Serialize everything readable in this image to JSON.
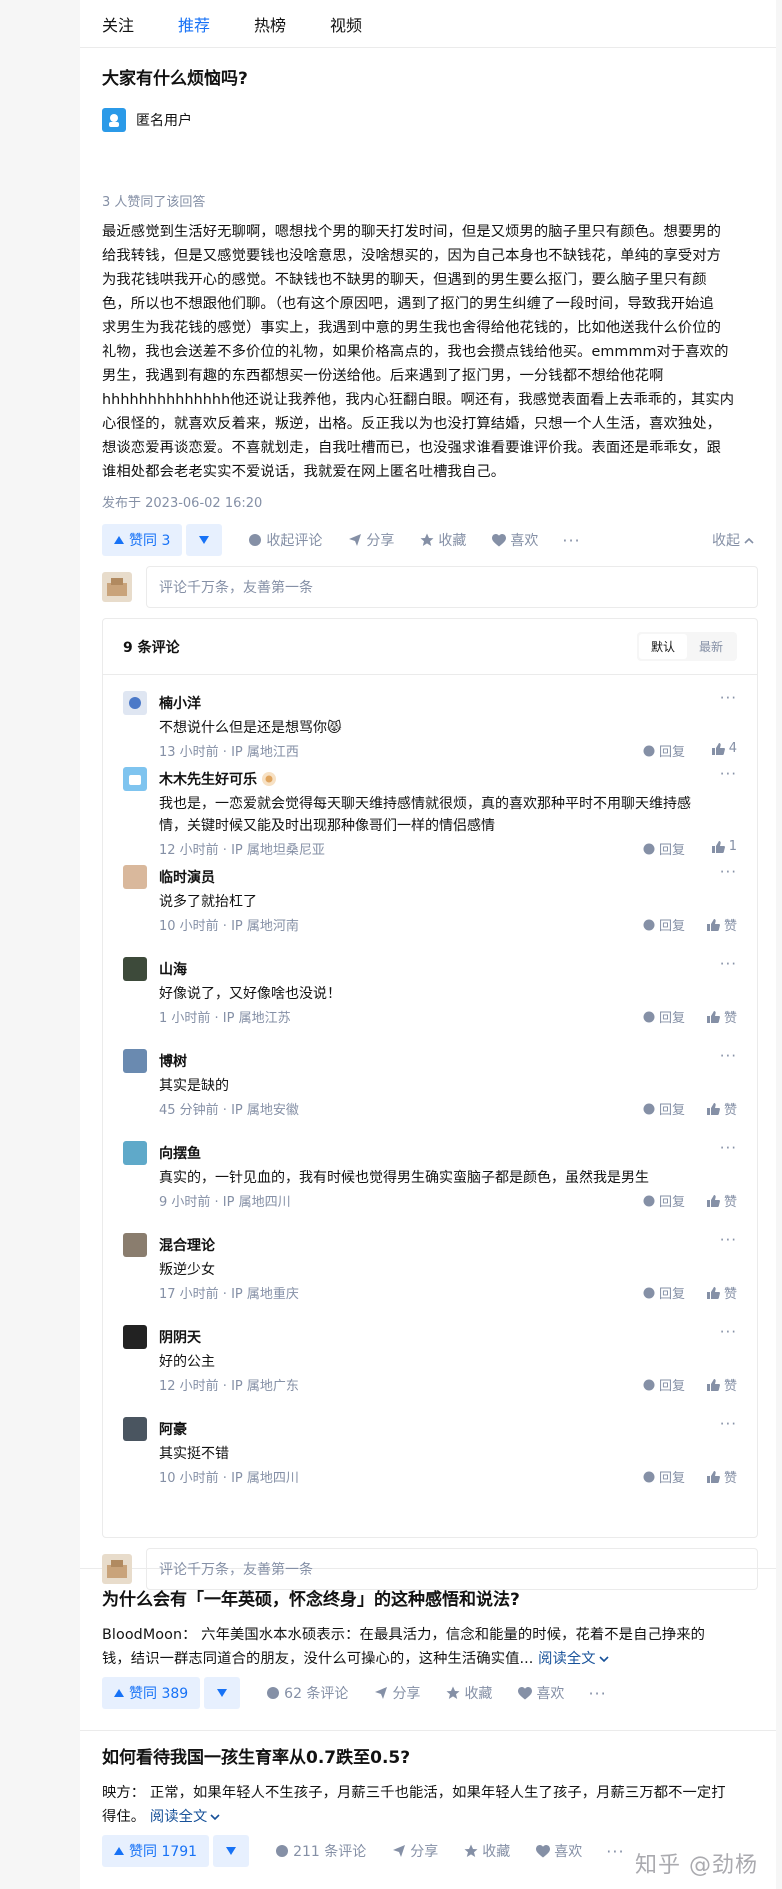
{
  "nav": {
    "tabs": [
      "关注",
      "推荐",
      "热榜",
      "视频"
    ],
    "active": 1
  },
  "answer": {
    "title": "大家有什么烦恼吗?",
    "author": "匿名用户",
    "upvoted_by": "3 人赞同了该回答",
    "lines": [
      "最近感觉到生活好无聊啊，嗯想找个男的聊天打发时间，但是又烦男的脑子里只有颜色。想要男的",
      "给我转钱，但是又感觉要钱也没啥意思，没啥想买的，因为自己本身也不缺钱花，单纯的享受对方",
      "为我花钱哄我开心的感觉。不缺钱也不缺男的聊天，但遇到的男生要么抠门，要么脑子里只有颜",
      "色，所以也不想跟他们聊。（也有这个原因吧，遇到了抠门的男生纠缠了一段时间，导致我开始追",
      "求男生为我花钱的感觉）事实上，我遇到中意的男生我也舍得给他花钱的，比如他送我什么价位的",
      "礼物，我也会送差不多价位的礼物，如果价格高点的，我也会攒点钱给他买。emmmm对于喜欢的",
      "男生，我遇到有趣的东西都想买一份送给他。后来遇到了抠门男，一分钱都不想给他花啊",
      "hhhhhhhhhhhhhh他还说让我养他，我内心狂翻白眼。啊还有，我感觉表面看上去乖乖的，其实内",
      "心很怪的，就喜欢反着来，叛逆，出格。反正我以为也没打算结婚，只想一个人生活，喜欢独处，",
      "想谈恋爱再谈恋爱。不喜就划走，自我吐槽而已，也没强求谁看要谁评价我。表面还是乖乖女，跟",
      "谁相处都会老老实实不爱说话，我就爱在网上匿名吐槽我自己。"
    ],
    "published": "发布于 2023-06-02 16:20",
    "vote_label": "赞同 3",
    "collapse_comments": "收起评论",
    "share": "分享",
    "favorite": "收藏",
    "like": "喜欢",
    "collapse": "收起",
    "comment_placeholder": "评论千万条，友善第一条",
    "comment_count": "9 条评论",
    "sort_default": "默认",
    "sort_latest": "最新",
    "reply_label": "回复",
    "like_label": "赞"
  },
  "comments": [
    {
      "name": "楠小洋",
      "text": "不想说什么但是还是想骂你",
      "emoji": "😾",
      "meta": "13 小时前 · IP 属地江西",
      "likes": "4",
      "avatar_color": "#dfe6f2"
    },
    {
      "name": "木木先生好可乐",
      "badge": true,
      "text": "我也是，一恋爱就会觉得每天聊天维持感情就很烦，真的喜欢那种平时不用聊天维持感",
      "text2": "情，关键时候又能及时出现那种像哥们一样的情侣感情",
      "meta": "12 小时前 · IP 属地坦桑尼亚",
      "likes": "1",
      "avatar_color": "#7fc4ef"
    },
    {
      "name": "临时演员",
      "text": "说多了就抬杠了",
      "meta": "10 小时前 · IP 属地河南",
      "likes": "赞",
      "avatar_color": "#d9b89c"
    },
    {
      "name": "山海",
      "text": "好像说了，又好像啥也没说！",
      "meta": "1 小时前 · IP 属地江苏",
      "likes": "赞",
      "avatar_color": "#3d4a3a"
    },
    {
      "name": "博树",
      "text": "其实是缺的",
      "meta": "45 分钟前 · IP 属地安徽",
      "likes": "赞",
      "avatar_color": "#6a8ab0"
    },
    {
      "name": "向摆鱼",
      "text": "真实的，一针见血的，我有时候也觉得男生确实蛮脑子都是颜色，虽然我是男生",
      "meta": "9 小时前 · IP 属地四川",
      "likes": "赞",
      "avatar_color": "#5fa9c9"
    },
    {
      "name": "混合理论",
      "text": "叛逆少女",
      "meta": "17 小时前 · IP 属地重庆",
      "likes": "赞",
      "avatar_color": "#8a7d6e"
    },
    {
      "name": "阴阴天",
      "text": "好的公主",
      "meta": "12 小时前 · IP 属地广东",
      "likes": "赞",
      "avatar_color": "#222222"
    },
    {
      "name": "阿豪",
      "text": "其实挺不错",
      "meta": "10 小时前 · IP 属地四川",
      "likes": "赞",
      "avatar_color": "#4a5560"
    }
  ],
  "feed": [
    {
      "title": "为什么会有「一年英硕，怀念终身」的这种感悟和说法?",
      "excerpt1": "BloodMoon：  六年美国水本水硕表示：在最具活力，信念和能量的时候，花着不是自己挣来的",
      "excerpt2": "钱，结识一群志同道合的朋友，没什么可操心的，这种生活确实值...",
      "read_more": "阅读全文",
      "vote_label": "赞同 389",
      "comments": "62 条评论",
      "share": "分享",
      "favorite": "收藏",
      "like": "喜欢"
    },
    {
      "title": "如何看待我国一孩生育率从0.7跌至0.5?",
      "excerpt1": "映方：  正常，如果年轻人不生孩子，月薪三千也能活，如果年轻人生了孩子，月薪三万都不一定打",
      "excerpt2": "得住。",
      "read_more": "阅读全文",
      "vote_label": "赞同 1791",
      "comments": "211 条评论",
      "share": "分享",
      "favorite": "收藏",
      "like": "喜欢"
    }
  ],
  "watermark": "知乎 @劲杨"
}
